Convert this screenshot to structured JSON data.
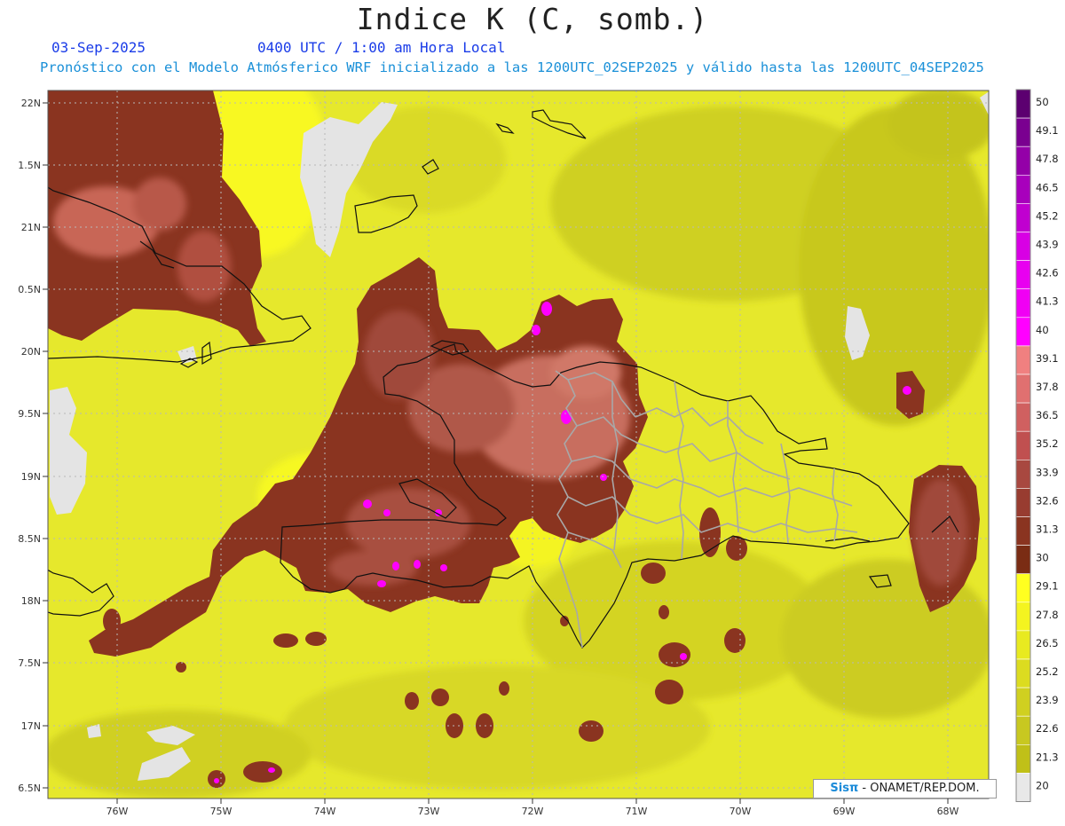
{
  "title": "Indice K (C, somb.)",
  "date": "03-Sep-2025",
  "time": "0400 UTC / 1:00 am Hora Local",
  "description": "Pronóstico con el Modelo Atmósferico WRF inicializado a las 1200UTC_02SEP2025 y válido hasta las  1200UTC_04SEP2025",
  "credit": {
    "brand": "Sisπ",
    "rest": " - ONAMET/REP.DOM."
  },
  "lat_labels": [
    "22N",
    "1.5N",
    "21N",
    "0.5N",
    "20N",
    "9.5N",
    "19N",
    "8.5N",
    "18N",
    "7.5N",
    "17N",
    "6.5N"
  ],
  "lon_labels": [
    "76W",
    "75W",
    "74W",
    "73W",
    "72W",
    "71W",
    "70W",
    "69W",
    "68W"
  ],
  "colorbar": {
    "levels": [
      "50",
      "49.1",
      "47.8",
      "46.5",
      "45.2",
      "43.9",
      "42.6",
      "41.3",
      "40",
      "39.1",
      "37.8",
      "36.5",
      "35.2",
      "33.9",
      "32.6",
      "31.3",
      "30",
      "29.1",
      "27.8",
      "26.5",
      "25.2",
      "23.9",
      "22.6",
      "21.3",
      "20"
    ],
    "colors": [
      "#5c0070",
      "#7a0090",
      "#9400a8",
      "#a800bc",
      "#c000d0",
      "#d800e4",
      "#e800f0",
      "#f000f4",
      "#ff00ff",
      "#f08080",
      "#e07070",
      "#d06060",
      "#c05050",
      "#a84840",
      "#983c30",
      "#8a3420",
      "#7a2c14",
      "#ffff20",
      "#f4f420",
      "#e8ea20",
      "#dcdc20",
      "#d0d020",
      "#c8c820",
      "#c0c018",
      "#e8e8e8"
    ]
  },
  "colors": {
    "land_gray": "#e4e4e4",
    "background_yellow": "#e8ea30",
    "hot_brown": "#8a3420"
  }
}
